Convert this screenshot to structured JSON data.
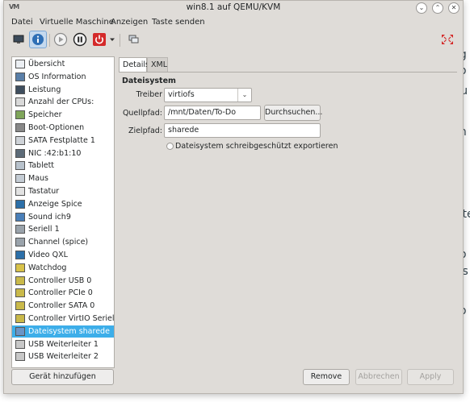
{
  "background": {
    "fragments": [
      "ng",
      "op",
      "r u",
      "tz",
      "un",
      "alte",
      "eb",
      "eis",
      "op"
    ]
  },
  "window": {
    "title": "win8.1 auf QEMU/KVM",
    "app_icon_text": "VM"
  },
  "menubar": {
    "items": [
      "Datei",
      "Virtuelle Maschine",
      "Anzeigen",
      "Taste senden"
    ]
  },
  "toolbar": {
    "buttons": [
      "monitor-icon",
      "info-icon",
      "play-icon",
      "pause-icon",
      "power-icon",
      "dropdown-arrow-icon",
      "snapshot-icon",
      "fullscreen-icon"
    ]
  },
  "sidebar": {
    "items": [
      {
        "label": "Übersicht",
        "icon": "overview-icon"
      },
      {
        "label": "OS Information",
        "icon": "os-info-icon"
      },
      {
        "label": "Leistung",
        "icon": "performance-icon"
      },
      {
        "label": "Anzahl der CPUs:",
        "icon": "cpu-icon"
      },
      {
        "label": "Speicher",
        "icon": "memory-icon"
      },
      {
        "label": "Boot-Optionen",
        "icon": "boot-options-icon"
      },
      {
        "label": "SATA Festplatte 1",
        "icon": "disk-icon"
      },
      {
        "label": "NIC :42:b1:10",
        "icon": "nic-icon"
      },
      {
        "label": "Tablett",
        "icon": "tablet-icon"
      },
      {
        "label": "Maus",
        "icon": "mouse-icon"
      },
      {
        "label": "Tastatur",
        "icon": "keyboard-icon"
      },
      {
        "label": "Anzeige Spice",
        "icon": "display-icon"
      },
      {
        "label": "Sound ich9",
        "icon": "sound-icon"
      },
      {
        "label": "Seriell 1",
        "icon": "serial-icon"
      },
      {
        "label": "Channel (spice)",
        "icon": "channel-icon"
      },
      {
        "label": "Video QXL",
        "icon": "video-icon"
      },
      {
        "label": "Watchdog",
        "icon": "watchdog-icon"
      },
      {
        "label": "Controller USB 0",
        "icon": "controller-icon"
      },
      {
        "label": "Controller PCIe 0",
        "icon": "controller-icon"
      },
      {
        "label": "Controller SATA 0",
        "icon": "controller-icon"
      },
      {
        "label": "Controller VirtIO Seriell 0",
        "icon": "controller-icon"
      },
      {
        "label": "Dateisystem sharede",
        "icon": "filesystem-icon"
      },
      {
        "label": "USB Weiterleiter 1",
        "icon": "usb-redirect-icon"
      },
      {
        "label": "USB Weiterleiter 2",
        "icon": "usb-redirect-icon"
      }
    ],
    "selected_index": 21,
    "add_button": "Gerät hinzufügen"
  },
  "tabs": [
    "Details",
    "XML"
  ],
  "details": {
    "section_title": "Dateisystem",
    "driver_label": "Treiber",
    "driver_value": "virtiofs",
    "source_label": "Quellpfad:",
    "source_value": "/mnt/Daten/To-Do",
    "browse_button": "Durchsuchen...",
    "target_label": "Zielpfad:",
    "target_value": "sharede",
    "readonly_label": "Dateisystem schreibgeschützt exportieren",
    "readonly_checked": false
  },
  "footer": {
    "remove": "Remove",
    "cancel": "Abbrechen",
    "apply": "Apply"
  }
}
